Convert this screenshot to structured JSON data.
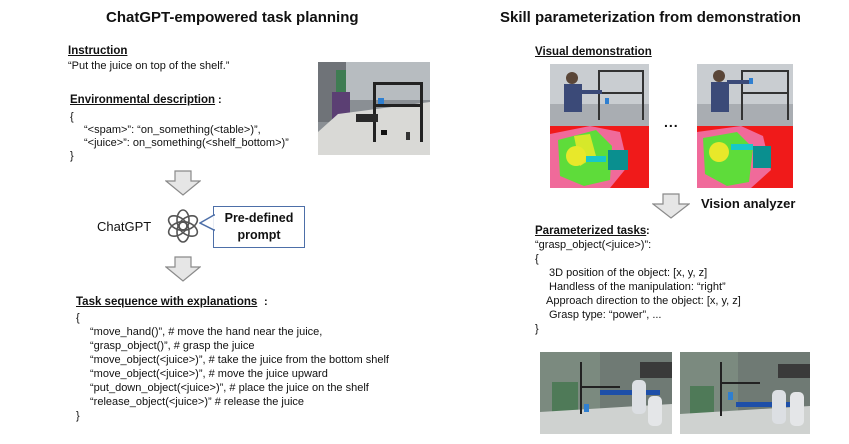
{
  "left": {
    "title": "ChatGPT-empowered task planning",
    "instruction_label": "Instruction",
    "instruction_text": "“Put the juice on top of the shelf.”",
    "env_label": "Environmental description",
    "env_lines": [
      "{",
      "“<spam>”: “on_something(<table>)”,",
      "“<juice>”: on_something(<shelf_bottom>)”",
      "}"
    ],
    "chatgpt_label": "ChatGPT",
    "prompt_lines": [
      "Pre-defined",
      "prompt"
    ],
    "task_label": "Task sequence with explanations",
    "task_lines": [
      "{",
      "“move_hand()”, # move the hand near the juice,",
      "“grasp_object()”, # grasp the juice",
      "“move_object(<juice>)”, # take the juice from the bottom shelf",
      "“move_object(<juice>)”, # move the juice upward",
      "“put_down_object(<juice>)”, # place the juice on the shelf",
      "“release_object(<juice>)” # release the juice",
      "}"
    ]
  },
  "right": {
    "title": "Skill parameterization from demonstration",
    "visual_label": "Visual demonstration",
    "ellipsis": "...",
    "vision_label": "Vision analyzer",
    "param_label": "Parameterized tasks",
    "param_lines": [
      "“grasp_object(<juice>)”:",
      "{",
      "3D position of the object: [x, y, z]",
      "Handless of the manipulation: “right”",
      "Approach direction to the object: [x, y, z]",
      "Grasp type: “power”, ...",
      "}"
    ]
  },
  "colors": {
    "arrow_fill": "#e6e6e6",
    "arrow_stroke": "#8a8a8a",
    "prompt_border": "#4d6fa8"
  },
  "icons": [
    "openai-logo-icon",
    "down-arrow-icon"
  ]
}
